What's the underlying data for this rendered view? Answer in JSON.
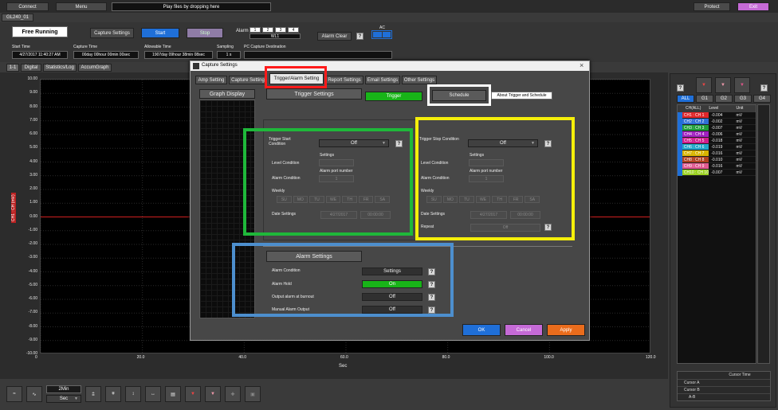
{
  "topbar": {
    "connect": "Connect",
    "menu": "Menu",
    "playfiles": "Play files by dropping here",
    "protect": "Protect",
    "exit": "Exit"
  },
  "device_tab": "GL240_01",
  "status": {
    "mode": "Free Running",
    "capture_settings": "Capture Settings",
    "start": "Start",
    "stop": "Stop",
    "alarm_label": "Alarm",
    "alarm_nums": [
      "1",
      "2",
      "3",
      "4"
    ],
    "alarm_w": "WL1",
    "alarm_clear": "Alarm Clear",
    "ac_label": "AC",
    "start_time_label": "Start Time",
    "start_time": "4/27/2017 11:40:27 AM",
    "capture_time_label": "Capture Time",
    "capture_time": "00day 00hour 00min 00sec",
    "allowable_label": "Allowable Time",
    "allowable": "1907day 09hour 38min 08sec",
    "sampling_label": "Sampling",
    "sampling": "1 s",
    "pc_dest_label": "PC Capture Destination",
    "pc_dest": ""
  },
  "view_tabs": [
    "1-1",
    "Digital",
    "Statistics/Log",
    "AccumGraph"
  ],
  "graph": {
    "y_ticks": [
      "10.00",
      "9.00",
      "8.00",
      "7.00",
      "6.00",
      "5.00",
      "4.00",
      "3.00",
      "2.00",
      "1.00",
      "0.00",
      "-1.00",
      "-2.00",
      "-3.00",
      "-4.00",
      "-5.00",
      "-6.00",
      "-7.00",
      "-8.00",
      "-9.00",
      "-10.00"
    ],
    "x_ticks": [
      "0",
      "20.0",
      "40.0",
      "60.0",
      "80.0",
      "100.0",
      "120.0"
    ],
    "x_label": "Sec",
    "ch_label": "CH1 : CH (mV)",
    "time_span": "2Min",
    "time_unit": "Sec"
  },
  "dialog": {
    "title": "Capture Settings",
    "close": "×",
    "tabs": [
      "Amp Setting",
      "Capture Setting",
      "Trigger/Alarm Setting",
      "Report Settings",
      "Email Settings",
      "Other Settings"
    ],
    "graph_display": "Graph Display",
    "trigger_settings": "Trigger Settings",
    "trigger_btn": "Trigger",
    "schedule_btn": "Schedule",
    "about": "About Trigger and Schedule",
    "start": {
      "condition_label": "Trigger Start Condition",
      "condition": "Off",
      "settings_label": "Settings",
      "level_label": "Level Condition",
      "port_label": "Alarm port number",
      "alarm_label": "Alarm Condition",
      "port_val": "1",
      "weekly_label": "Weekly",
      "days": [
        "SU",
        "MO",
        "TU",
        "WE",
        "TH",
        "FR",
        "SA"
      ],
      "date_label": "Date Settings",
      "date": "4/27/2017",
      "time": "00:00:00"
    },
    "stop": {
      "condition_label": "Trigger Stop Condition",
      "condition": "Off",
      "settings_label": "Settings",
      "level_label": "Level Condition",
      "port_label": "Alarm port number",
      "alarm_label": "Alarm Condition",
      "port_val": "1",
      "weekly_label": "Weekly",
      "days": [
        "SU",
        "MO",
        "TU",
        "WE",
        "TH",
        "FR",
        "SA"
      ],
      "date_label": "Date Settings",
      "date": "4/27/2017",
      "time": "00:00:00",
      "repeat_label": "Repeat",
      "repeat": "Off"
    },
    "alarm": {
      "title": "Alarm Settings",
      "condition_label": "Alarm Condition",
      "condition": "Settings",
      "hold_label": "Alarm Hold",
      "hold": "On",
      "burnout_label": "Output alarm at burnout",
      "burnout": "Off",
      "manual_label": "Manual Alarm Output",
      "manual": "Off"
    },
    "ok": "OK",
    "cancel": "Cancel",
    "apply": "Apply",
    "help": "?"
  },
  "right_panel": {
    "group_tabs": [
      "ALL",
      "G1",
      "G2",
      "G3",
      "G4"
    ],
    "headers": [
      "CH(ALL)",
      "Level",
      "Unit"
    ],
    "rows": [
      {
        "ch": "CH1 : CH 1",
        "level": "-0.004",
        "unit": "mV",
        "color": "#e0262a"
      },
      {
        "ch": "CH2 : CH 2",
        "level": "-0.002",
        "unit": "mV",
        "color": "#2f6fd6"
      },
      {
        "ch": "CH3 : CH 3",
        "level": "-0.007",
        "unit": "mV",
        "color": "#1e9e3a"
      },
      {
        "ch": "CH4 : CH 4",
        "level": "-0.006",
        "unit": "mV",
        "color": "#a020c0"
      },
      {
        "ch": "CH5 : CH 5",
        "level": "-0.018",
        "unit": "mV",
        "color": "#d01c8b"
      },
      {
        "ch": "CH6 : CH 6",
        "level": "-0.019",
        "unit": "mV",
        "color": "#22a7c8"
      },
      {
        "ch": "CH7 : CH 7",
        "level": "-0.016",
        "unit": "mV",
        "color": "#d8b400"
      },
      {
        "ch": "CH8 : CH 8",
        "level": "-0.010",
        "unit": "mV",
        "color": "#b04020"
      },
      {
        "ch": "CH9 : CH 9",
        "level": "-0.016",
        "unit": "mV",
        "color": "#e05a90"
      },
      {
        "ch": "CH10 : CH 10",
        "level": "-0.007",
        "unit": "mV",
        "color": "#9ad020"
      }
    ],
    "cursor_time": "Cursor Time",
    "cursors": [
      "Cursor A",
      "Cursor B",
      "A-B"
    ]
  }
}
